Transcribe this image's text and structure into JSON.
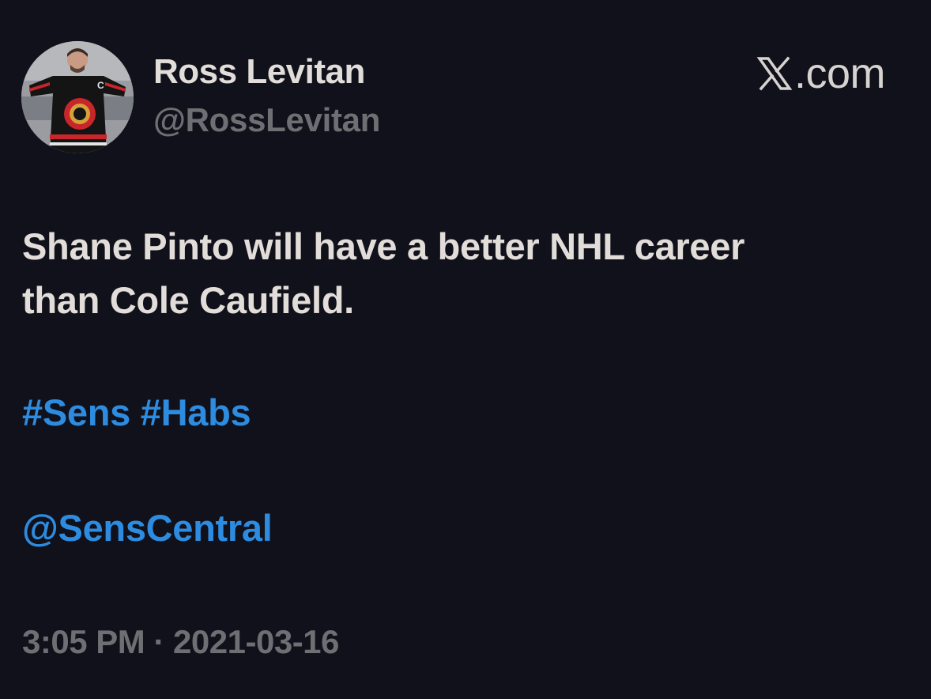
{
  "author": {
    "display_name": "Ross Levitan",
    "handle": "@RossLevitan",
    "avatar_icon": "profile-photo-hockey-jersey"
  },
  "brand": {
    "logo_icon": "x-logo-icon",
    "label": ".com"
  },
  "tweet": {
    "text_lines": [
      "Shane Pinto will have a better NHL career",
      "than Cole Caufield."
    ],
    "hashtags": [
      "#Sens",
      "#Habs"
    ],
    "mention": "@SensCentral",
    "timestamp": "3:05 PM · 2021-03-16"
  },
  "colors": {
    "background": "#10111a",
    "primary_text": "#e2ddd9",
    "secondary_text": "#6e6e73",
    "link": "#2d8ce0"
  }
}
